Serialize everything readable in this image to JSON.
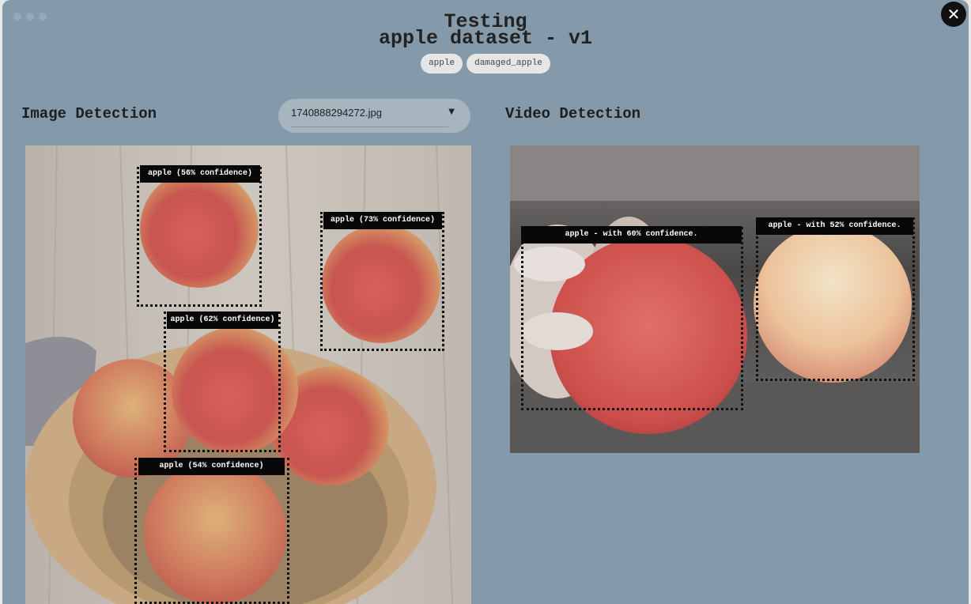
{
  "header": {
    "title_line1": "Testing",
    "title_line2": "apple dataset - v1"
  },
  "classes": [
    "apple",
    "damaged_apple"
  ],
  "image_detection": {
    "title": "Image Detection",
    "selected_file": "1740888294272.jpg",
    "detections": [
      {
        "label": "apple (56% confidence)"
      },
      {
        "label": "apple (73% confidence)"
      },
      {
        "label": "apple (62% confidence)"
      },
      {
        "label": "apple (54% confidence)"
      }
    ]
  },
  "video_detection": {
    "title": "Video Detection",
    "detections": [
      {
        "label": "apple - with 60% confidence."
      },
      {
        "label": "apple - with 52% confidence."
      }
    ]
  },
  "icons": {
    "close": "close-icon",
    "dropdown": "caret-down-icon"
  },
  "colors": {
    "background": "#8499a9",
    "label_bg": "#080808",
    "chip_bg": "#e6e6e6"
  }
}
